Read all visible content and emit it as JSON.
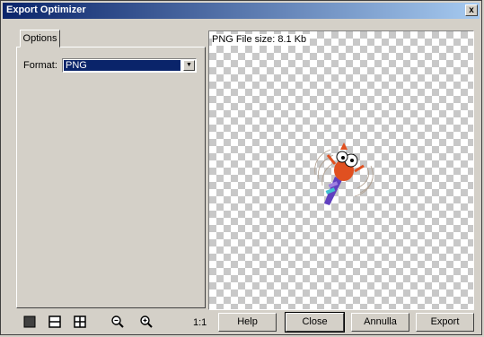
{
  "window": {
    "title": "Export Optimizer",
    "close_label": "x"
  },
  "tabs": [
    {
      "label": "Options"
    }
  ],
  "options": {
    "format_label": "Format:",
    "format_value": "PNG"
  },
  "preview": {
    "file_size_text": "PNG File size:   8.1 Kb"
  },
  "toolbar": {
    "icons": [
      "single-view-icon",
      "split-horizontal-view-icon",
      "four-pane-view-icon",
      "zoom-out-icon",
      "zoom-in-icon"
    ],
    "zoom_ratio": "1:1"
  },
  "buttons": {
    "help": "Help",
    "close": "Close",
    "annulla": "Annulla",
    "export": "Export"
  },
  "colors": {
    "title_gradient_start": "#0a246a",
    "title_gradient_end": "#a6caf0",
    "selection": "#0a246a",
    "dialog_face": "#d4d0c8"
  }
}
